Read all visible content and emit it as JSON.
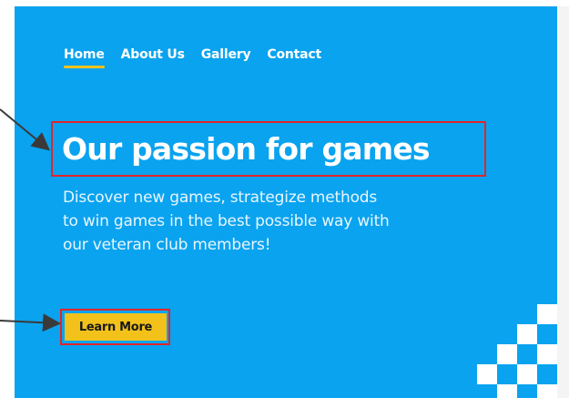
{
  "nav": {
    "items": [
      {
        "label": "Home",
        "active": true
      },
      {
        "label": "About Us",
        "active": false
      },
      {
        "label": "Gallery",
        "active": false
      },
      {
        "label": "Contact",
        "active": false
      }
    ]
  },
  "hero": {
    "title": "Our passion for games",
    "description": "Discover new games, strategize methods to win games in the best possible way with our veteran club members!",
    "cta_label": "Learn More"
  },
  "colors": {
    "background": "#0aa3ef",
    "accent": "#f2c21b",
    "highlight_border": "#e0262b",
    "text": "#ffffff"
  }
}
